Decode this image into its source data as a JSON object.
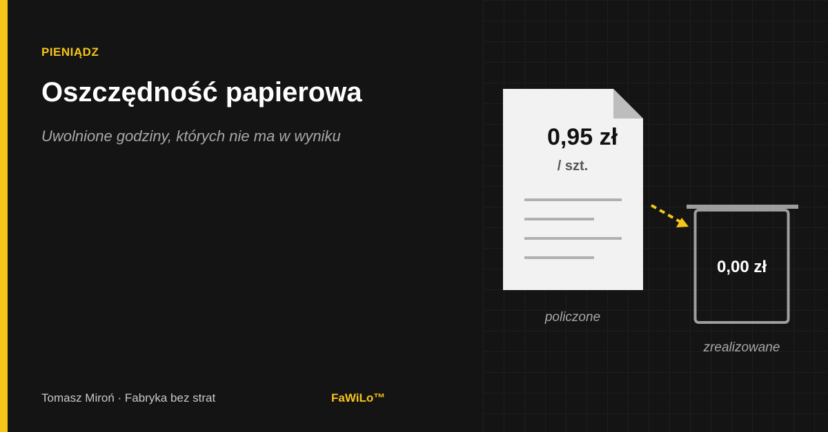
{
  "header": {
    "category": "PIENIĄDZ",
    "title": "Oszczędność papierowa",
    "subtitle": "Uwolnione godziny, których nie ma w wyniku"
  },
  "document": {
    "price": "0,95 zł",
    "unit": "/ szt.",
    "caption": "policzone"
  },
  "bin": {
    "value": "0,00 zł",
    "caption": "zrealizowane"
  },
  "footer": {
    "author": "Tomasz Miroń · Fabryka bez strat",
    "brand": "FaWiLo™"
  },
  "colors": {
    "accent": "#f5c518",
    "background": "#141414",
    "document": "#f2f2f2",
    "bin_outline": "#9e9e9e"
  },
  "icons": {
    "document": "document-icon",
    "arrow": "arrow-icon",
    "bin": "bin-icon"
  }
}
